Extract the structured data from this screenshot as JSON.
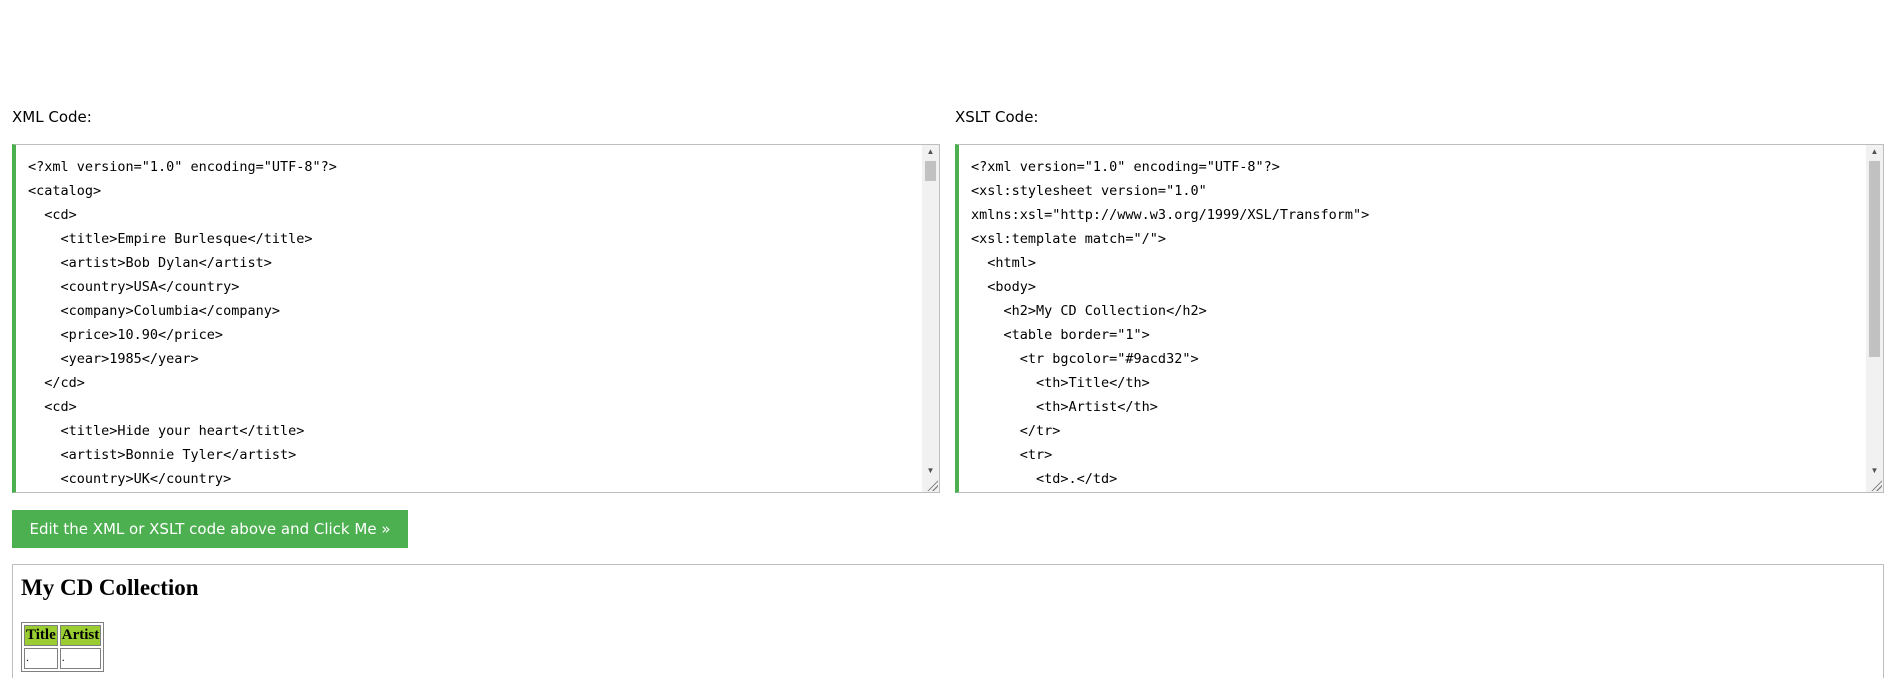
{
  "xml_panel": {
    "label": "XML Code:",
    "code": "<?xml version=\"1.0\" encoding=\"UTF-8\"?>\n<catalog>\n  <cd>\n    <title>Empire Burlesque</title>\n    <artist>Bob Dylan</artist>\n    <country>USA</country>\n    <company>Columbia</company>\n    <price>10.90</price>\n    <year>1985</year>\n  </cd>\n  <cd>\n    <title>Hide your heart</title>\n    <artist>Bonnie Tyler</artist>\n    <country>UK</country>"
  },
  "xslt_panel": {
    "label": "XSLT Code:",
    "code": "<?xml version=\"1.0\" encoding=\"UTF-8\"?>\n<xsl:stylesheet version=\"1.0\"\nxmlns:xsl=\"http://www.w3.org/1999/XSL/Transform\">\n<xsl:template match=\"/\">\n  <html>\n  <body>\n    <h2>My CD Collection</h2>\n    <table border=\"1\">\n      <tr bgcolor=\"#9acd32\">\n        <th>Title</th>\n        <th>Artist</th>\n      </tr>\n      <tr>\n        <td>.</td>"
  },
  "submit_button": {
    "label": "Edit the XML or XSLT code above and Click Me »",
    "color": "#4caf50"
  },
  "result": {
    "heading": "My CD Collection",
    "table": {
      "headers": [
        "Title",
        "Artist"
      ],
      "rows": [
        [
          ".",
          " ."
        ]
      ],
      "header_color": "#9acd32"
    }
  },
  "icons": {
    "scroll_up": "triangle-up",
    "scroll_down": "triangle-down",
    "resize": "resize-grip"
  }
}
